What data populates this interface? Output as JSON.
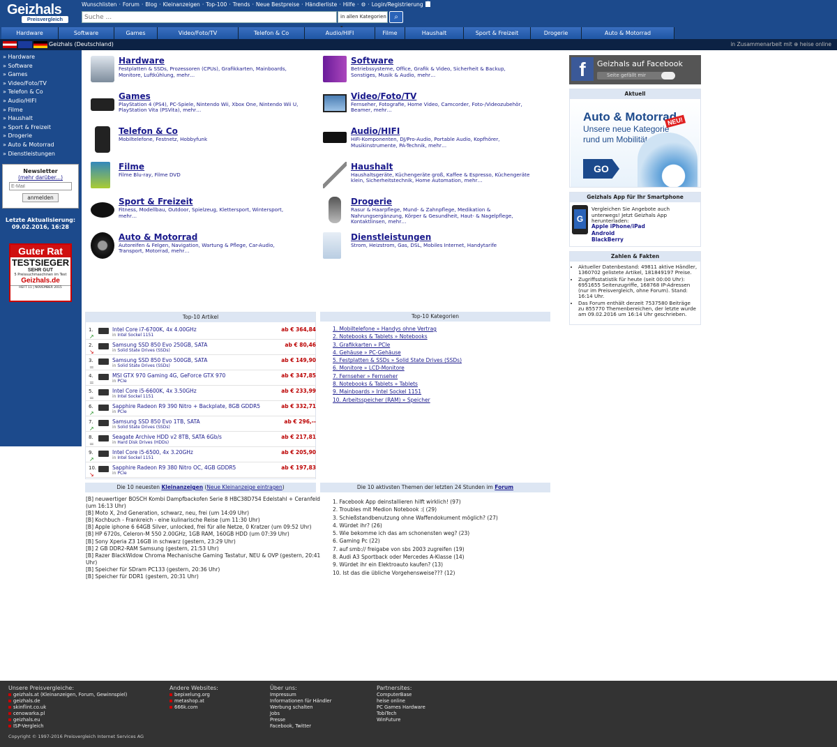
{
  "header": {
    "logo_line1": "Geizhals",
    "logo_line2": "Preisvergleich",
    "toplinks": [
      "Wunschlisten",
      "·",
      "Forum",
      "·",
      "Blog",
      "·",
      "Kleinanzeigen",
      "·",
      "Top-100",
      "·",
      "Trends",
      "·",
      "Neue Bestpreise",
      "·",
      "Händlerliste",
      "·",
      "Hilfe",
      "·",
      "⚙",
      "·",
      "Login/Registrierung"
    ],
    "search_placeholder": "Suche ...",
    "category_select": "in allen Kategorien ▾",
    "search_icon": "magnifier-icon",
    "fb_icon": "f"
  },
  "catnav": [
    {
      "label": "Hardware",
      "w": 82
    },
    {
      "label": "Software",
      "w": 80
    },
    {
      "label": "Games",
      "w": 62
    },
    {
      "label": "Video/Foto/TV",
      "w": 116
    },
    {
      "label": "Telefon & Co",
      "w": 95
    },
    {
      "label": "Audio/HIFI",
      "w": 101
    },
    {
      "label": "Filme",
      "w": 43
    },
    {
      "label": "Haushalt",
      "w": 84
    },
    {
      "label": "Sport & Freizeit",
      "w": 96
    },
    {
      "label": "Drogerie",
      "w": 73
    },
    {
      "label": "Auto & Motorrad",
      "w": 133
    }
  ],
  "subbar": {
    "country": "Geizhals (Deutschland)",
    "partner": "in Zusammenarbeit mit ⊕ heise online"
  },
  "sidebar": {
    "nav": [
      "» Hardware",
      "» Software",
      "» Games",
      "» Video/Foto/TV",
      "» Telefon & Co",
      "» Audio/HIFI",
      "» Filme",
      "» Haushalt",
      "» Sport & Freizeit",
      "» Drogerie",
      "» Auto & Motorrad",
      "» Dienstleistungen"
    ],
    "newsletter_title": "Newsletter",
    "newsletter_more": "(mehr darüber...)",
    "email_placeholder": "E-Mail",
    "subscribe": "anmelden",
    "last_update_label": "Letzte Aktualisierung:",
    "last_update": "09.02.2016, 16:28",
    "badge": {
      "l1": "Guter Rat",
      "l2": "TESTSIEGER",
      "l3": "SEHR GUT",
      "l4": "5 Preissuchmaschinen im Test",
      "l5": "Geizhals.de",
      "l6": "HEFT 11 | NOVEMBER 2015"
    }
  },
  "categories": [
    {
      "name": "Hardware",
      "desc": "Festplatten & SSDs, Prozessoren (CPUs), Grafikkarten, Mainboards, Monitore, Luftkühlung, mehr…",
      "icon": "hdd-icon"
    },
    {
      "name": "Software",
      "desc": "Betriebssysteme, Office, Grafik & Video, Sicherheit & Backup, Sonstiges, Musik & Audio, mehr…",
      "icon": "software-box-icon"
    },
    {
      "name": "Games",
      "desc": "PlayStation 4 (PS4), PC-Spiele, Nintendo Wii, Xbox One, Nintendo Wii U, PlayStation Vita (PSVita), mehr…",
      "icon": "console-icon"
    },
    {
      "name": "Video/Foto/TV",
      "desc": "Fernseher, Fotografie, Home Video, Camcorder, Foto-/Videozubehör, Beamer, mehr…",
      "icon": "tv-icon"
    },
    {
      "name": "Telefon & Co",
      "desc": "Mobiltelefone, Festnetz, Hobbyfunk",
      "icon": "smartphone-icon"
    },
    {
      "name": "Audio/HIFI",
      "desc": "HiFi-Komponenten, DJ/Pro-Audio, Portable Audio, Kopfhörer, Musikinstrumente, PA-Technik, mehr…",
      "icon": "receiver-icon"
    },
    {
      "name": "Filme",
      "desc": "Filme Blu-ray, Filme DVD",
      "icon": "movie-icon"
    },
    {
      "name": "Haushalt",
      "desc": "Haushaltsgeräte, Küchengeräte groß, Kaffee & Espresso, Küchengeräte klein, Sicherheitstechnik, Home Automation, mehr…",
      "icon": "vacuum-icon"
    },
    {
      "name": "Sport & Freizeit",
      "desc": "Fitness, Modellbau, Outdoor, Spielzeug, Klettersport, Wintersport, mehr…",
      "icon": "fitness-band-icon"
    },
    {
      "name": "Drogerie",
      "desc": "Rasur & Haarpflege, Mund- & Zahnpflege, Medikation & Nahrungsergänzung, Körper & Gesundheit, Haut- & Nagelpflege, Kontaktlinsen, mehr…",
      "icon": "shaver-icon"
    },
    {
      "name": "Auto & Motorrad",
      "desc": "Autoreifen & Felgen, Navigation, Wartung & Pflege, Car-Audio, Transport, Motorrad, mehr…",
      "icon": "tire-icon"
    },
    {
      "name": "Dienstleistungen",
      "desc": "Strom, Heizstrom, Gas, DSL, Mobiles Internet, Handytarife",
      "icon": "document-gear-icon"
    }
  ],
  "top_articles": {
    "title": "Top-10 Artikel",
    "rows": [
      {
        "n": "1.",
        "trend": "↗",
        "name": "Intel Core i7-6700K, 4x 4.00GHz",
        "cat": "Intel Sockel 1151",
        "price": "ab € 364,84"
      },
      {
        "n": "2.",
        "trend": "↘",
        "name": "Samsung SSD 850 Evo 250GB, SATA",
        "cat": "Solid State Drives (SSDs)",
        "price": "ab € 80,46"
      },
      {
        "n": "3.",
        "trend": "=",
        "name": "Samsung SSD 850 Evo 500GB, SATA",
        "cat": "Solid State Drives (SSDs)",
        "price": "ab € 149,90"
      },
      {
        "n": "4.",
        "trend": "=",
        "name": "MSI GTX 970 Gaming 4G, GeForce GTX 970",
        "cat": "PCIe",
        "price": "ab € 347,85"
      },
      {
        "n": "5.",
        "trend": "=",
        "name": "Intel Core i5-6600K, 4x 3.50GHz",
        "cat": "Intel Sockel 1151",
        "price": "ab € 233,99"
      },
      {
        "n": "6.",
        "trend": "↗",
        "name": "Sapphire Radeon R9 390 Nitro + Backplate, 8GB GDDR5",
        "cat": "PCIe",
        "price": "ab € 332,71"
      },
      {
        "n": "7.",
        "trend": "↗",
        "name": "Samsung SSD 850 Evo 1TB, SATA",
        "cat": "Solid State Drives (SSDs)",
        "price": "ab € 296,--"
      },
      {
        "n": "8.",
        "trend": "=",
        "name": "Seagate Archive HDD v2 8TB, SATA 6Gb/s",
        "cat": "Hard Disk Drives (HDDs)",
        "price": "ab € 217,81"
      },
      {
        "n": "9.",
        "trend": "↗",
        "name": "Intel Core i5-6500, 4x 3.20GHz",
        "cat": "Intel Sockel 1151",
        "price": "ab € 205,90"
      },
      {
        "n": "10.",
        "trend": "↘",
        "name": "Sapphire Radeon R9 380 Nitro OC, 4GB GDDR5",
        "cat": "PCIe",
        "price": "ab € 197,83"
      }
    ],
    "in_label": "in"
  },
  "top_categories": {
    "title": "Top-10 Kategorien",
    "rows": [
      "1. Mobiltelefone » Handys ohne Vertrag",
      "2. Notebooks & Tablets » Notebooks",
      "3. Grafikkarten » PCIe",
      "4. Gehäuse » PC-Gehäuse",
      "5. Festplatten & SSDs » Solid State Drives (SSDs)",
      "6. Monitore » LCD-Monitore",
      "7. Fernseher » Fernseher",
      "8. Notebooks & Tablets » Tablets",
      "9. Mainboards » Intel Sockel 1151",
      "10. Arbeitsspeicher (RAM) » Speicher"
    ]
  },
  "classifieds": {
    "title_pre": "Die 10 neuesten ",
    "title_link": "Kleinanzeigen",
    "title_post": " (",
    "title_link2": "Neue Kleinanzeige eintragen",
    "title_end": ")",
    "rows": [
      "[B] neuwertiger BOSCH Kombi Dampfbackofen Serie 8 HBC38D754 Edelstahl + Ceranfeld",
      "(um 16:13 Uhr)",
      "[B] Moto X, 2nd Generation, schwarz, neu, frei (um 14:09 Uhr)",
      "[B] Kochbuch - Frankreich - eine kulinarische Reise (um 11:30 Uhr)",
      "[B] Apple iphone 6 64GB Silver, unlocked, frei für alle Netze, 0 Kratzer (um 09:52 Uhr)",
      "[B] HP 6720s, Celeron-M 550 2.00GHz, 1GB RAM, 160GB HDD (um 07:39 Uhr)",
      "[B] Sony Xperia Z3 16GB in schwarz (gestern, 23:29 Uhr)",
      "[B] 2 GB DDR2-RAM Samsung (gestern, 21:53 Uhr)",
      "[B] Razer BlackWidow Chroma Mechanische Gaming Tastatur, NEU & OVP (gestern, 20:41",
      "Uhr)",
      "[B] Speicher für SDram PC133 (gestern, 20:36 Uhr)",
      "[B] Speicher für DDR1 (gestern, 20:31 Uhr)"
    ]
  },
  "forum": {
    "title_pre": "Die 10 aktivsten Themen der letzten 24 Stunden im ",
    "title_link": "Forum",
    "rows": [
      "1. Facebook App deinstallieren hilft wirklich! (97)",
      "2. Troubles mit Medion Notebook :( (29)",
      "3. Schießstandbenutzung ohne Waffendokument möglich? (27)",
      "4. Würdet ihr? (26)",
      "5. Wie bekomme ich das am schonensten weg? (23)",
      "6. Gaming Pc (22)",
      "7. auf smb:// freigabe von sbs 2003 zugreifen (19)",
      "8. Audi A3 Sportback oder Mercedes A-Klasse (14)",
      "9. Würdet ihr ein Elektroauto kaufen? (13)",
      "10. Ist das die übliche Vorgehensweise??? (12)"
    ]
  },
  "right": {
    "facebook_title": "Geizhals auf Facebook",
    "facebook_like": "Seite gefällt mir",
    "aktuell": "Aktuell",
    "promo_l1": "Auto & Motorrad",
    "promo_l2": "Unsere neue Kategorie",
    "promo_l3": "rund um Mobilität.",
    "promo_new": "NEU!",
    "promo_go": "GO",
    "app_title": "Geizhals App für Ihr Smartphone",
    "app_text": "Vergleichen Sie Angebote auch unterwegs! Jetzt Geizhals App herunterladen:",
    "app_links": [
      "Apple iPhone/iPad",
      "Android",
      "BlackBerry"
    ],
    "facts_title": "Zahlen & Fakten",
    "facts": [
      "Aktueller Datenbestand: 49811 aktive Händler, 1360702 gelistete Artikel, 181849197 Preise.",
      "Zugriffsstatistik für heute (seit 00:00 Uhr): 6951655 Seitenzugriffe, 168768 IP-Adressen (nur im Preisvergleich, ohne Forum). Stand: 16:14 Uhr.",
      "Das Forum enthält derzeit 7537580 Beiträge zu 855770 Themenbereichen, der letzte wurde am 09.02.2016 um 16:14 Uhr geschrieben."
    ]
  },
  "footer": {
    "cols": [
      {
        "h": "Unsere Preisvergleiche:",
        "items": [
          "geizhals.at (Kleinanzeigen, Forum, Gewinnspiel)",
          "geizhals.de",
          "skinflint.co.uk",
          "cenowarka.pl",
          "geizhals.eu",
          "ISP-Vergleich"
        ]
      },
      {
        "h": "Andere Websites:",
        "items": [
          "bepixelung.org",
          "metashop.at",
          "666k.com"
        ]
      },
      {
        "h": "Über uns:",
        "items": [
          "Impressum",
          "Informationen für Händler",
          "Werbung schalten",
          "Jobs",
          "Presse",
          "Facebook, Twitter"
        ]
      },
      {
        "h": "Partnersites:",
        "items": [
          "ComputerBase",
          "heise online",
          "PC Games Hardware",
          "TobiTech",
          "WinFuture"
        ]
      }
    ],
    "copyright": "Copyright © 1997-2016 Preisvergleich Internet Services AG"
  }
}
